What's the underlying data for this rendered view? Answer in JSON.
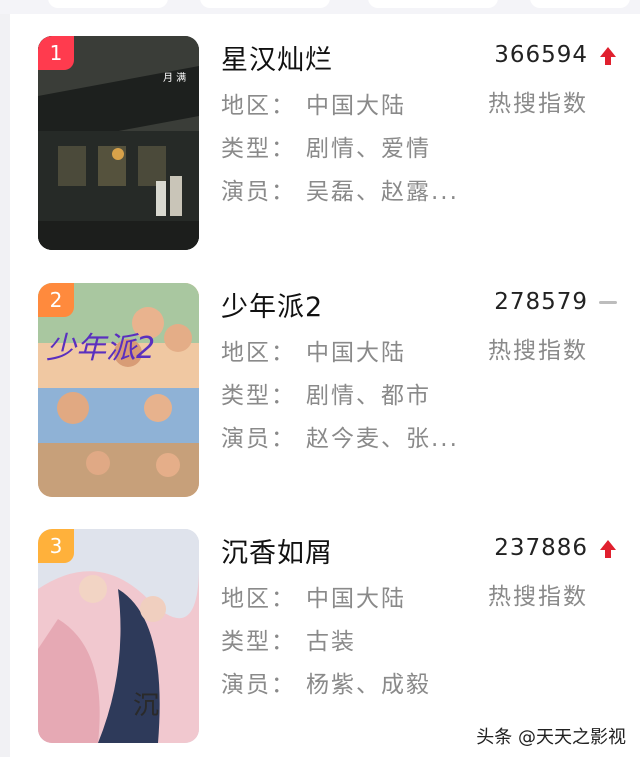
{
  "rankings": [
    {
      "rank": "1",
      "rank_color": "#ff3b4e",
      "title": "星汉灿烂",
      "score": "366594",
      "trend": "up",
      "heat_label": "热搜指数",
      "region_label": "地区：",
      "region": "中国大陆",
      "genre_label": "类型：",
      "genre": "剧情、爱情",
      "cast_label": "演员：",
      "cast": "吴磊、赵露..."
    },
    {
      "rank": "2",
      "rank_color": "#ff8a3d",
      "title": "少年派2",
      "score": "278579",
      "trend": "flat",
      "heat_label": "热搜指数",
      "region_label": "地区：",
      "region": "中国大陆",
      "genre_label": "类型：",
      "genre": "剧情、都市",
      "cast_label": "演员：",
      "cast": "赵今麦、张..."
    },
    {
      "rank": "3",
      "rank_color": "#ffb13b",
      "title": "沉香如屑",
      "score": "237886",
      "trend": "up",
      "heat_label": "热搜指数",
      "region_label": "地区：",
      "region": "中国大陆",
      "genre_label": "类型：",
      "genre": "古装",
      "cast_label": "演员：",
      "cast": "杨紫、成毅"
    }
  ],
  "watermark": "头条 @天天之影视",
  "colors": {
    "trend_up": "#e0202e",
    "trend_flat": "#bdbdbd"
  }
}
